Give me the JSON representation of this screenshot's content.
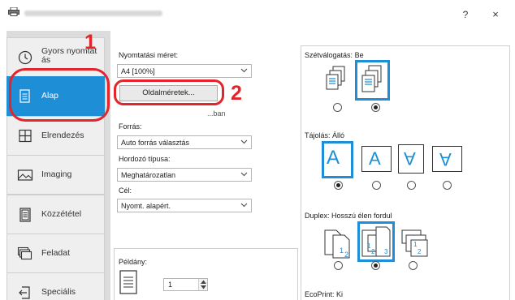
{
  "window": {
    "help_label": "?",
    "close_label": "×"
  },
  "sidebar": {
    "items": [
      {
        "label": "Gyors nyomtat",
        "label2": "ás"
      },
      {
        "label": "Alap"
      },
      {
        "label": "Elrendezés"
      },
      {
        "label": "Imaging"
      },
      {
        "label": "Közzététel"
      },
      {
        "label": "Feladat"
      },
      {
        "label": "Speciális"
      }
    ],
    "active": "Alap"
  },
  "callouts": {
    "one": "1",
    "two": "2"
  },
  "basic": {
    "print_size_label": "Nyomtatási méret:",
    "print_size_value": "A4 [100%]",
    "page_sizes_button": "Oldalméretek...",
    "partial_hidden_label": "...ban",
    "source_label": "Forrás:",
    "source_value": "Auto forrás választás",
    "media_type_label": "Hordozó típusa:",
    "media_type_value": "Meghatározatlan",
    "destination_label": "Cél:",
    "destination_value": "Nyomt. alapért.",
    "copies_label": "Példány:",
    "copies_value": "1"
  },
  "collate": {
    "label": "Szétválogatás:",
    "value": "Be",
    "selected": 1
  },
  "orientation": {
    "label": "Tájolás:",
    "value": "Álló",
    "selected": 0,
    "glyph": "A"
  },
  "duplex": {
    "label": "Duplex:",
    "value": "Hosszú élen fordul",
    "selected": 1
  },
  "ecoprint": {
    "label": "EcoPrint:",
    "value": "Ki"
  },
  "colors": {
    "accent": "#1e8fd6",
    "callout": "#e3242b"
  }
}
